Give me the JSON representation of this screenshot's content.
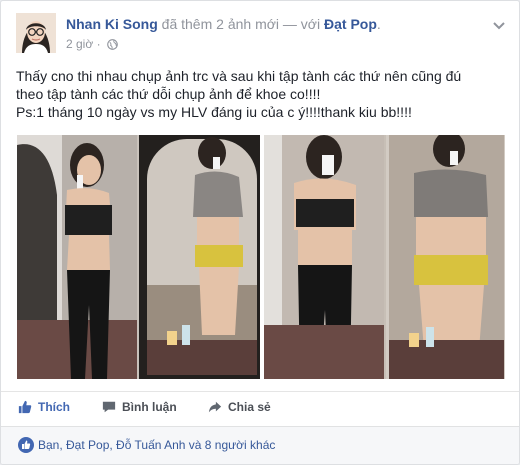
{
  "post": {
    "author": "Nhan Ki Song",
    "action_text": "đã thêm 2 ảnh mới — với",
    "tagged_user": "Đạt Pop",
    "time": "2 giờ",
    "dot": "·",
    "avatar_icon": "profile-photo",
    "privacy_icon": "globe-icon",
    "menu_icon": "chevron-down-icon",
    "text_lines": [
      "Thấy cno thi nhau chụp ảnh trc và sau khi tập tành các thứ nên cũng đú",
      "theo tập tành các thứ dỗi chụp ảnh để khoe co!!!!",
      "Ps:1 tháng 10 ngày vs my HLV đáng iu của c ý!!!!thank kiu bb!!!!"
    ]
  },
  "photos": [
    {
      "name": "before-after-photo-left",
      "description": "mirror selfies"
    },
    {
      "name": "before-after-photo-right",
      "description": "mirror selfies"
    }
  ],
  "actions": {
    "like": "Thích",
    "comment": "Bình luận",
    "share": "Chia sẻ"
  },
  "likes": {
    "summary": "Bạn, Đạt Pop, Đỗ Tuấn Anh và 8 người khác"
  },
  "colors": {
    "link": "#365899",
    "like_blue": "#4267b2",
    "muted": "#90949c",
    "text": "#1d2129"
  }
}
